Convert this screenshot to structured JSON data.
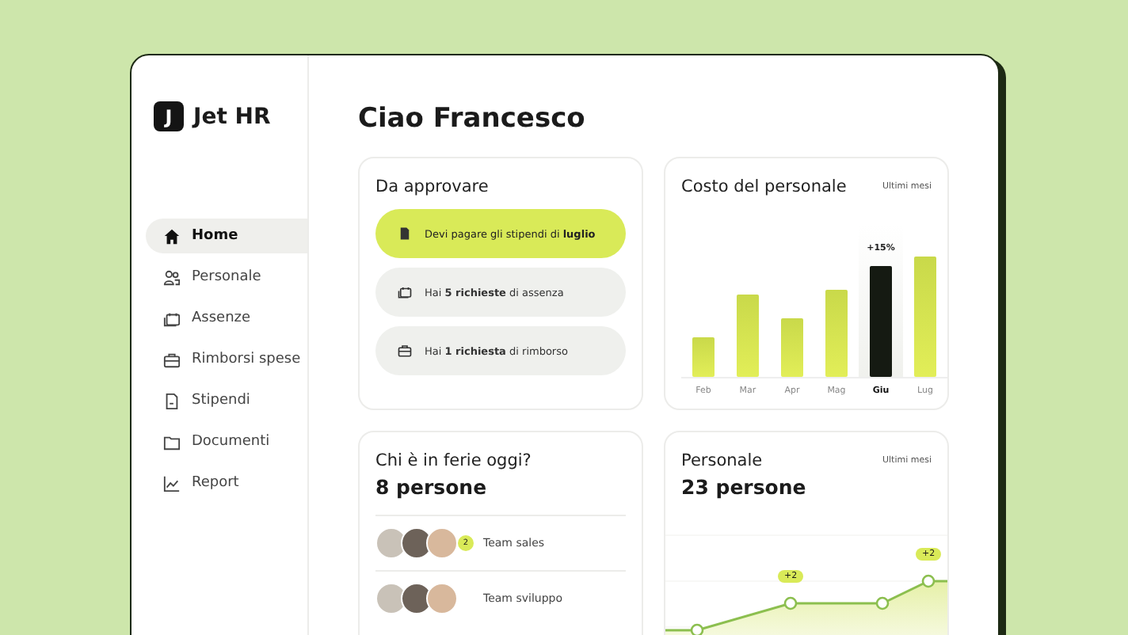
{
  "brand": {
    "logo_letter": "J",
    "name": "Jet HR"
  },
  "sidebar": {
    "items": [
      {
        "label": "Home",
        "selected": true
      },
      {
        "label": "Personale",
        "selected": false
      },
      {
        "label": "Assenze",
        "selected": false
      },
      {
        "label": "Rimborsi spese",
        "selected": false
      },
      {
        "label": "Stipendi",
        "selected": false
      },
      {
        "label": "Documenti",
        "selected": false
      },
      {
        "label": "Report",
        "selected": false
      }
    ]
  },
  "greeting": "Ciao Francesco",
  "approvals": {
    "title": "Da approvare",
    "items": [
      {
        "text": "Devi pagare gli stipendi di **luglio**",
        "highlighted": true
      },
      {
        "text": "Hai **5 richieste** di assenza",
        "highlighted": false
      },
      {
        "text": "Hai **1 richiesta** di rimborso",
        "highlighted": false
      }
    ]
  },
  "cost": {
    "title": "Costo del personale",
    "period": "Ultimi mesi",
    "badge": "+15%",
    "categories": [
      {
        "label": "Feb",
        "selected": false
      },
      {
        "label": "Mar",
        "selected": false
      },
      {
        "label": "Apr",
        "selected": false
      },
      {
        "label": "Mag",
        "selected": false
      },
      {
        "label": "Giu",
        "selected": true
      },
      {
        "label": "Lug",
        "selected": false
      }
    ]
  },
  "vacation": {
    "title": "Chi è in ferie oggi?",
    "count": "8 persone",
    "teams": [
      {
        "name": "Team sales",
        "extra": "2"
      },
      {
        "name": "Team sviluppo"
      }
    ]
  },
  "staff": {
    "title": "Personale",
    "count": "23 persone",
    "period": "Ultimi mesi",
    "markers": [
      "+2",
      "+2"
    ]
  }
}
